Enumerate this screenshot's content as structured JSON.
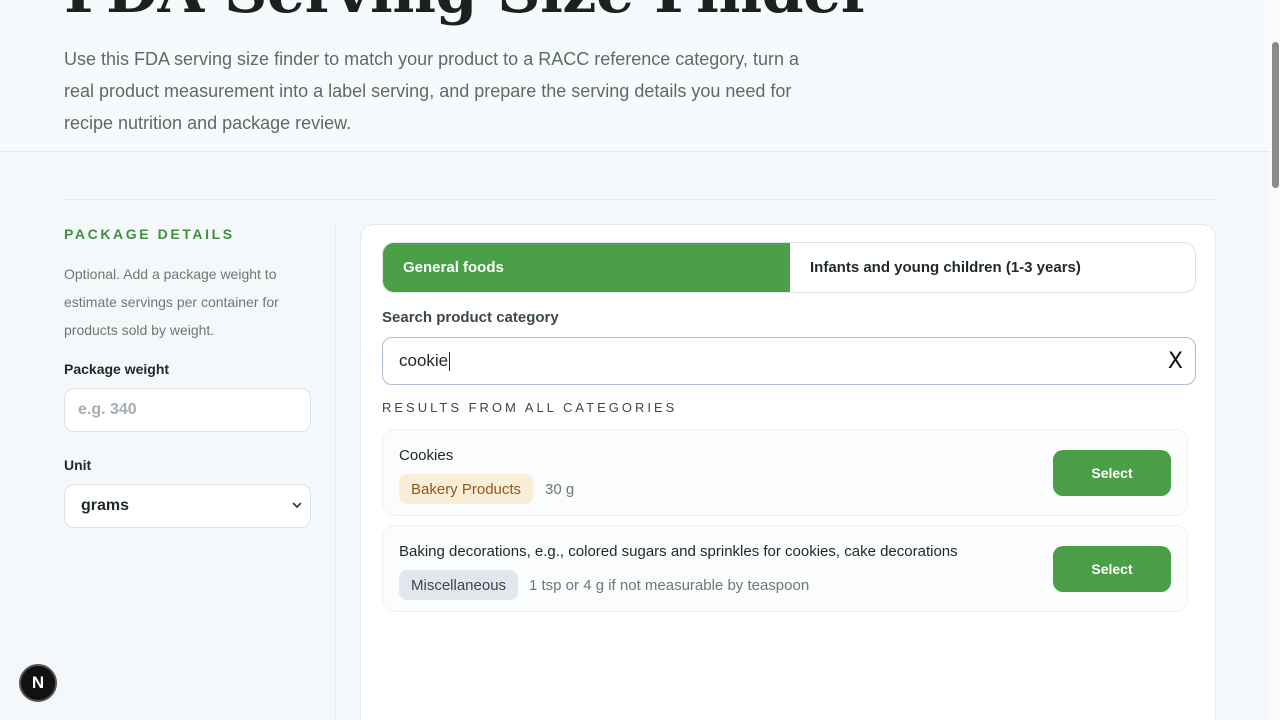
{
  "hero": {
    "title": "FDA Serving Size Finder",
    "description": "Use this FDA serving size finder to match your product to a RACC reference category, turn a real product measurement into a label serving, and prepare the serving details you need for recipe nutrition and package review."
  },
  "package": {
    "heading": "PACKAGE DETAILS",
    "help": "Optional. Add a package weight to estimate servings per container for products sold by weight.",
    "weight_label": "Package weight",
    "weight_placeholder": "e.g. 340",
    "unit_label": "Unit",
    "unit_value": "grams"
  },
  "tabs": [
    {
      "label": "General foods",
      "active": true
    },
    {
      "label": "Infants and young children (1-3 years)",
      "active": false
    }
  ],
  "search": {
    "label": "Search product category",
    "value": "cookie",
    "clear_label": "X"
  },
  "results": {
    "heading": "RESULTS FROM ALL CATEGORIES",
    "items": [
      {
        "name": "Cookies",
        "category": "Bakery Products",
        "serving": "30 g",
        "button": "Select"
      },
      {
        "name": "Baking decorations, e.g., colored sugars and sprinkles for cookies, cake decorations",
        "category": "Miscellaneous",
        "serving": "1 tsp or 4 g if not measurable by teaspoon",
        "button": "Select"
      }
    ]
  },
  "fab": {
    "label": "N"
  },
  "colors": {
    "accent": "#4a9f47",
    "heading_green": "#3f8f3f",
    "bakery_badge": "#fbeed6",
    "misc_badge": "#e2e7ee"
  }
}
